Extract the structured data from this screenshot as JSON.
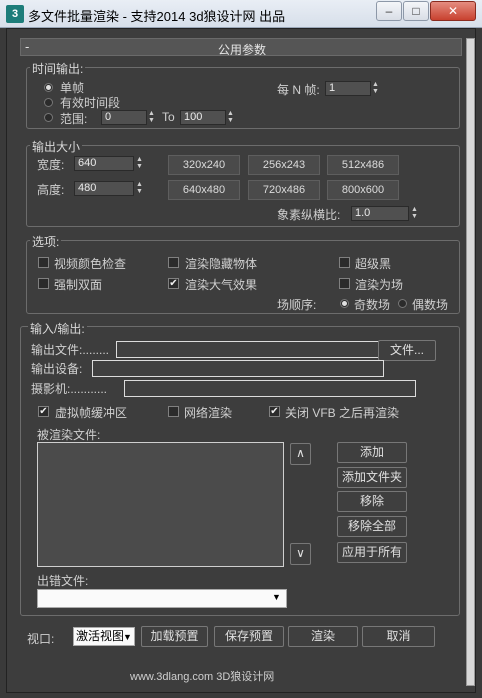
{
  "window": {
    "title": "多文件批量渲染 - 支持2014 3d狼设计网 出品",
    "icon_text": "3",
    "min_glyph": "–",
    "max_glyph": "□",
    "close_glyph": "✕"
  },
  "rollout": {
    "toggle": "-",
    "title": "公用参数"
  },
  "time_output": {
    "label": "时间输出:",
    "single": "单帧",
    "active_segment": "有效时间段",
    "range": "范围:",
    "range_from": "0",
    "range_to_label": "To",
    "range_to": "100",
    "every_nth_label": "每 N 帧:",
    "every_nth": "1"
  },
  "output_size": {
    "label": "输出大小",
    "width_label": "宽度:",
    "width": "640",
    "height_label": "高度:",
    "height": "480",
    "presets": [
      "320x240",
      "256x243",
      "512x486",
      "640x480",
      "720x486",
      "800x600"
    ],
    "pixel_aspect_label": "象素纵横比:",
    "pixel_aspect": "1.0"
  },
  "options": {
    "label": "选项:",
    "video_color_check": "视频颜色检查",
    "render_hidden": "渲染隐藏物体",
    "super_black": "超级黑",
    "force_2sided": "强制双面",
    "render_atmospherics": "渲染大气效果",
    "render_to_fields": "渲染为场",
    "field_order_label": "场顺序:",
    "odd": "奇数场",
    "even": "偶数场"
  },
  "io": {
    "label": "输入/输出:",
    "output_file": "输出文件:........",
    "file_button": "文件...",
    "output_device": "输出设备:",
    "camera": "摄影机:...........",
    "virtual_fb": "虚拟帧缓冲区",
    "net_render": "网络渲染",
    "close_vfb": "关闭 VFB 之后再渲染",
    "render_files_label": "被渲染文件:",
    "up": "∧",
    "down": "∨",
    "add": "添加",
    "add_folder": "添加文件夹",
    "remove": "移除",
    "remove_all": "移除全部",
    "apply_all": "应用于所有",
    "preset_file_label": "出错文件:"
  },
  "bottom": {
    "viewport_label": "视口:",
    "viewport_value": "激活视图",
    "load_preset": "加载预置",
    "save_preset": "保存预置",
    "render": "渲染",
    "cancel": "取消"
  },
  "footer": {
    "text": "www.3dlang.com  3D狼设计网"
  }
}
